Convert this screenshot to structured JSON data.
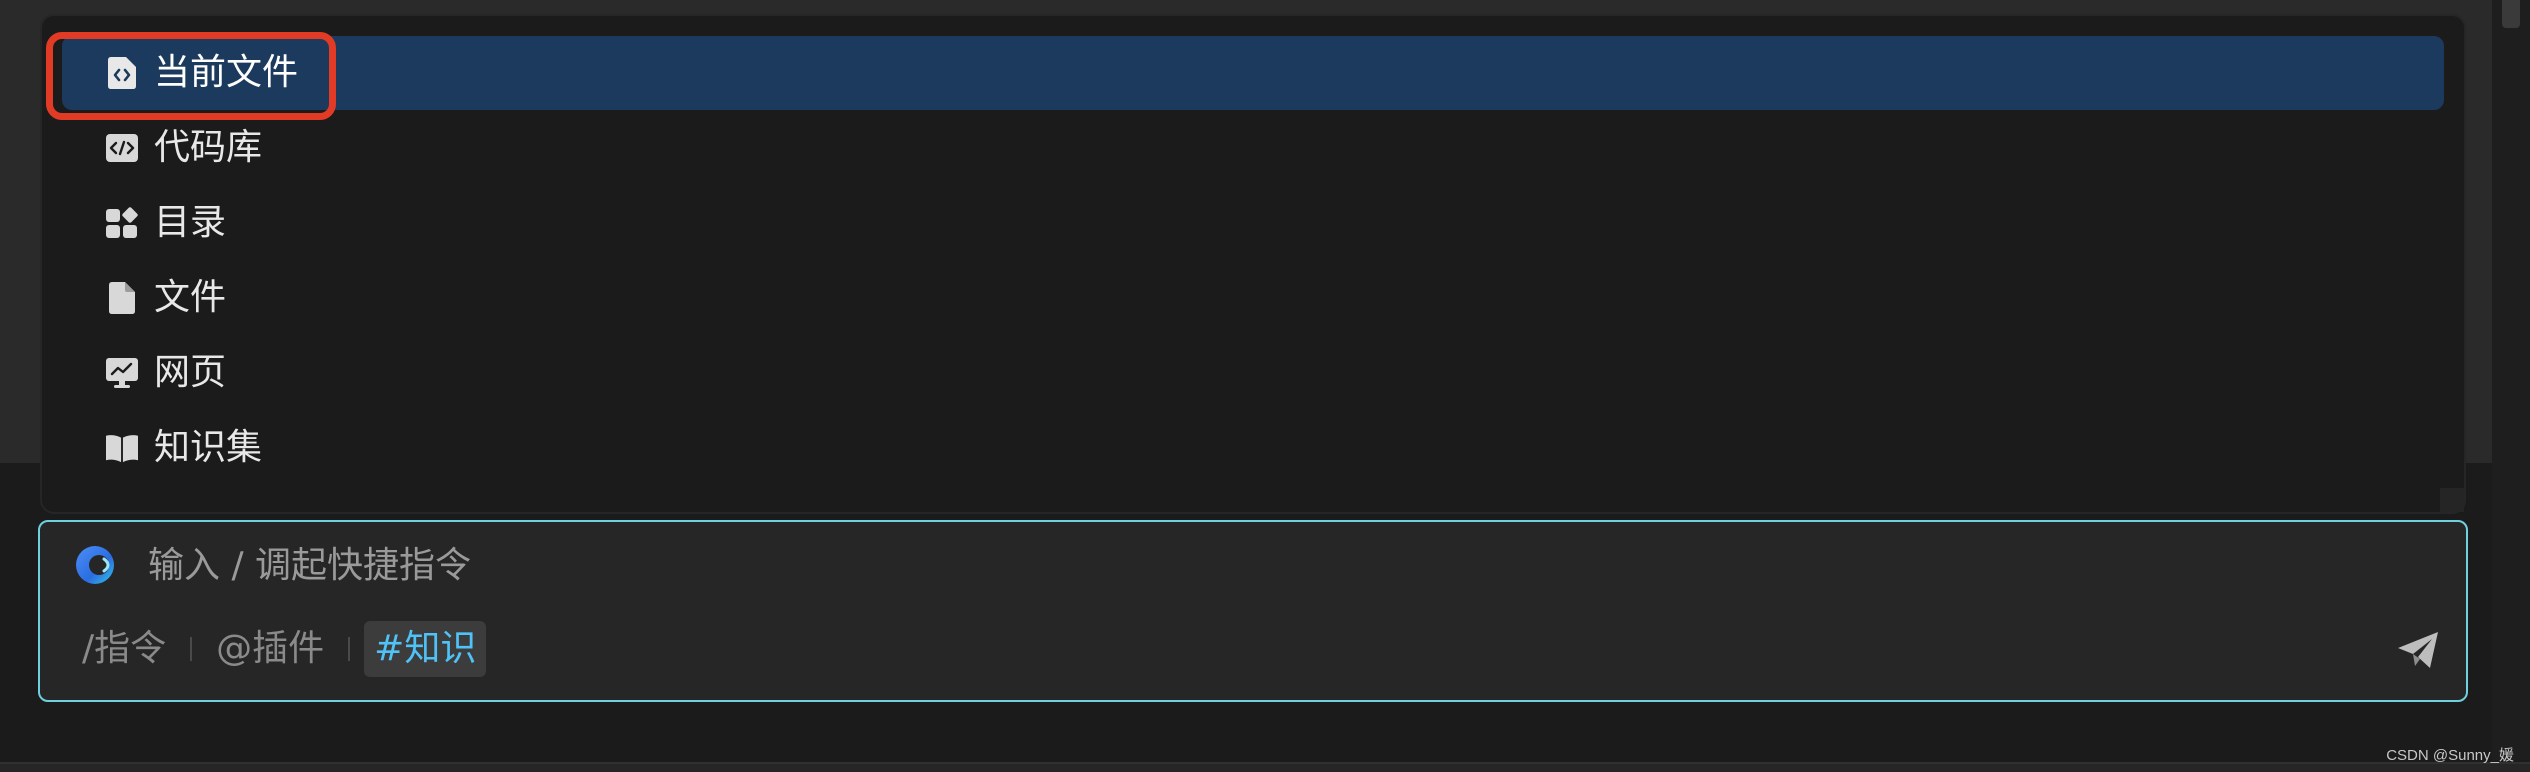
{
  "menu": {
    "items": [
      {
        "label": "当前文件",
        "icon": "file-code-icon",
        "active": true
      },
      {
        "label": "代码库",
        "icon": "code-icon",
        "active": false
      },
      {
        "label": "目录",
        "icon": "category-icon",
        "active": false
      },
      {
        "label": "文件",
        "icon": "file-icon",
        "active": false
      },
      {
        "label": "网页",
        "icon": "webpage-icon",
        "active": false
      },
      {
        "label": "知识集",
        "icon": "book-icon",
        "active": false
      }
    ]
  },
  "input": {
    "placeholder": "输入 / 调起快捷指令",
    "value": "",
    "brand_icon": "assistant-logo-icon"
  },
  "chips": {
    "command": "/指令",
    "plugin": "@插件",
    "knowledge": "#知识"
  },
  "send_icon": "send-icon",
  "watermark": "CSDN @Sunny_媛",
  "colors": {
    "accent_border": "#6fd0de",
    "active_item_bg": "#1c3a5e",
    "annotation_red": "#e23b25",
    "active_chip_text": "#4fc3f7"
  }
}
